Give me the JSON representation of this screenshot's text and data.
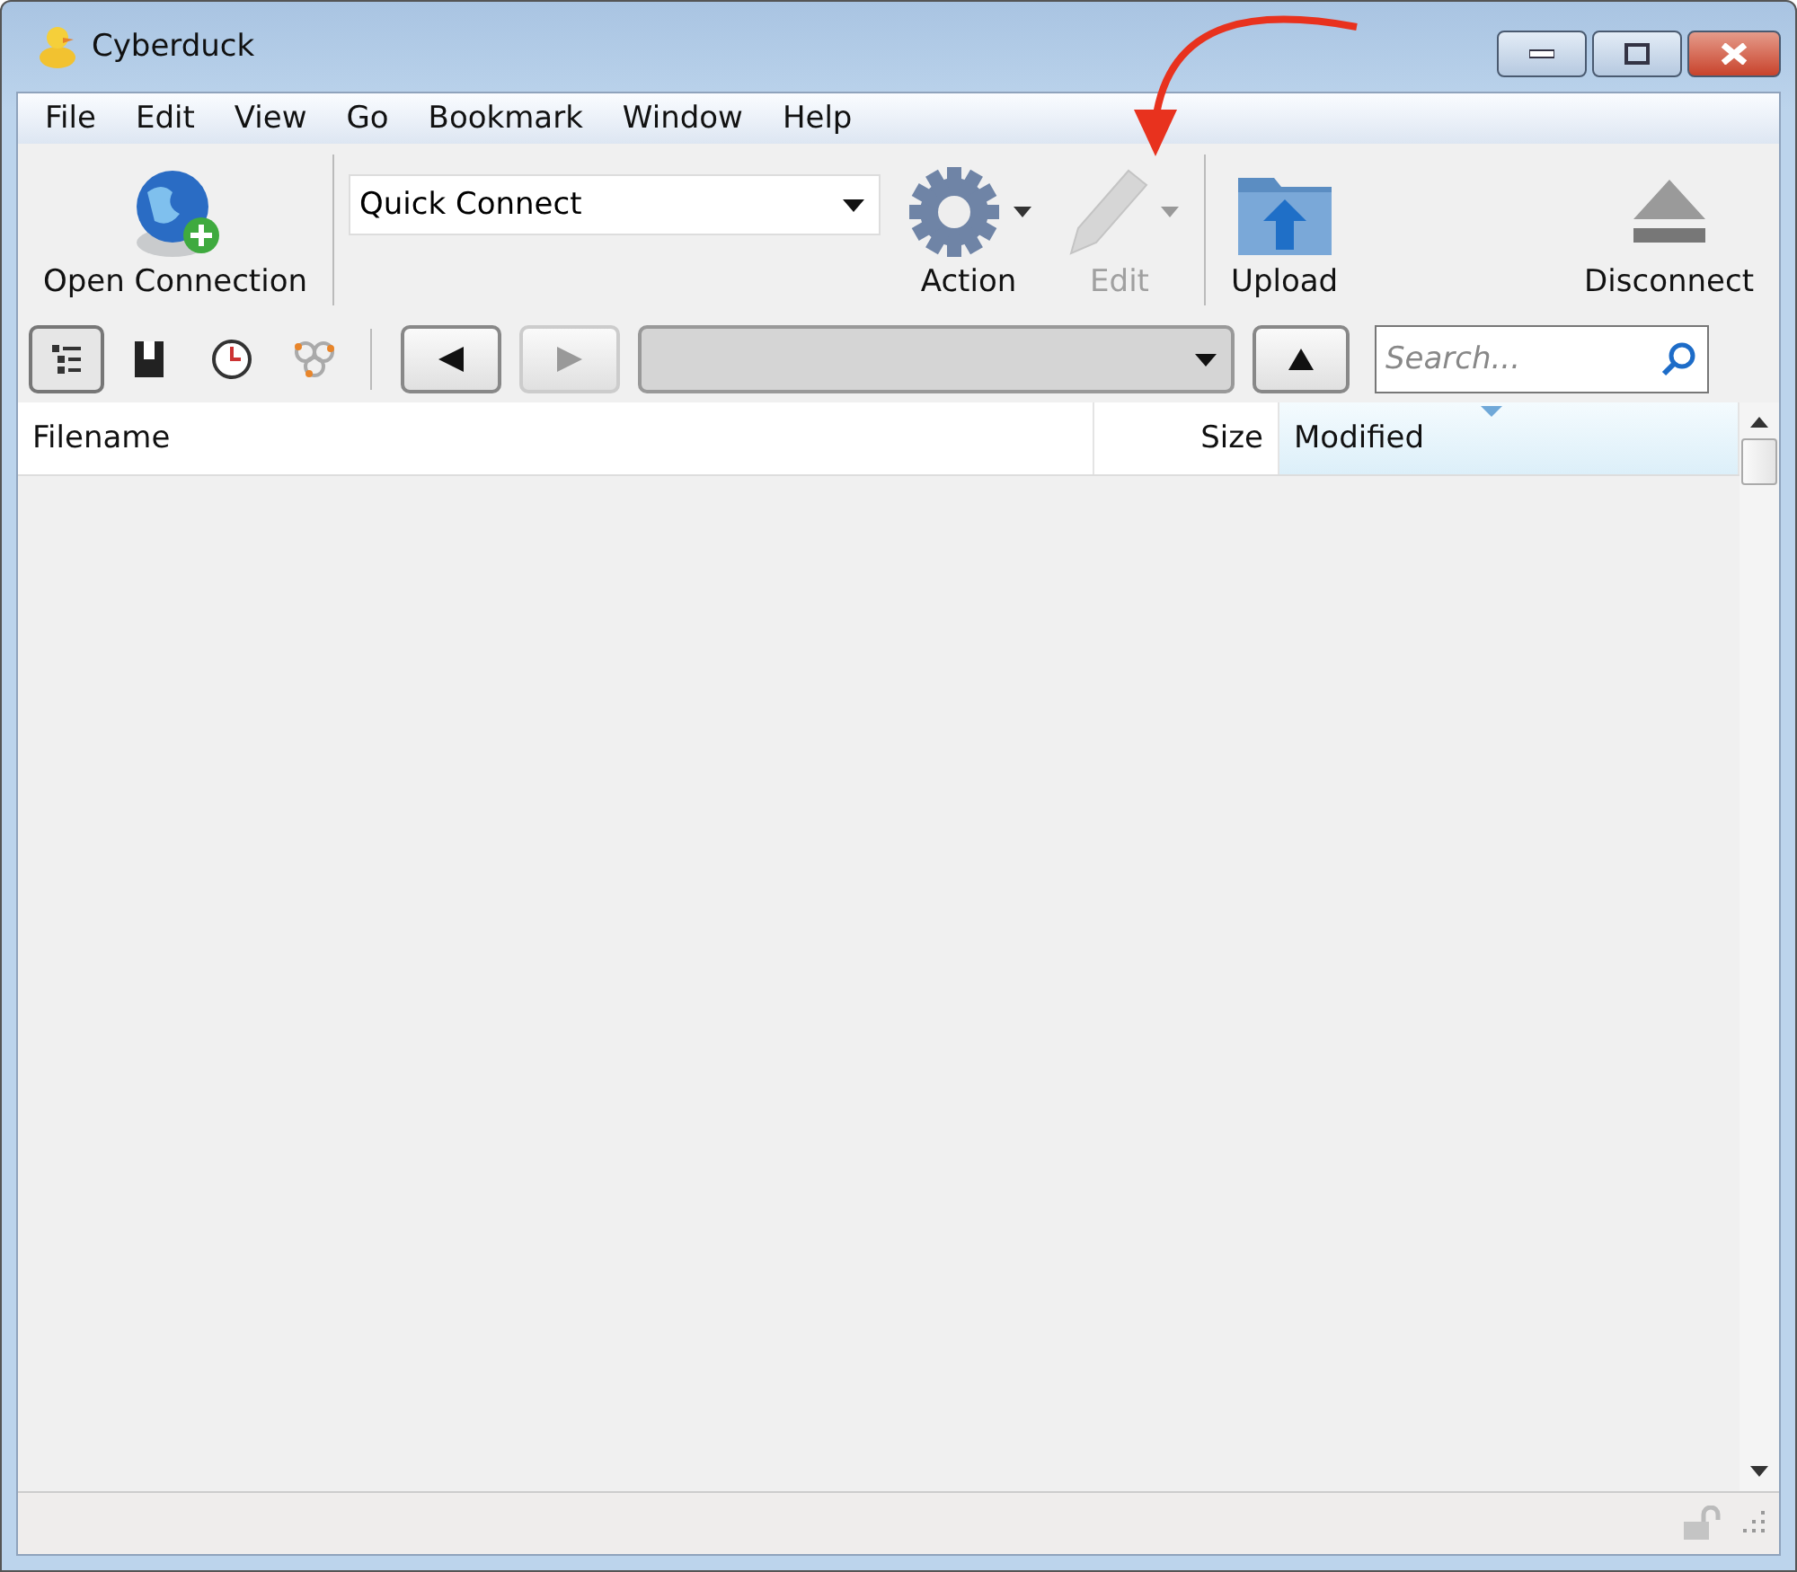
{
  "window": {
    "title": "Cyberduck"
  },
  "menu": [
    "File",
    "Edit",
    "View",
    "Go",
    "Bookmark",
    "Window",
    "Help"
  ],
  "toolbar": [
    {
      "kind": "connect",
      "label": "Open Connection",
      "disabled": false,
      "menu": false
    },
    {
      "kind": "combo",
      "value": "Quick Connect"
    },
    {
      "kind": "action",
      "label": "Action",
      "disabled": false,
      "menu": true
    },
    {
      "kind": "edit",
      "label": "Edit",
      "disabled": true,
      "menu": true
    },
    {
      "kind": "upload",
      "label": "Upload",
      "disabled": false,
      "menu": false
    },
    {
      "kind": "spacer"
    },
    {
      "kind": "disconnect",
      "label": "Disconnect",
      "disabled": false,
      "menu": false
    }
  ],
  "view_toggles": [
    {
      "selected": true
    },
    {
      "selected": false
    },
    {
      "selected": false
    },
    {
      "selected": false
    }
  ],
  "navigation": {
    "back_disabled": false,
    "forward_disabled": true
  },
  "search": {
    "placeholder": "Search..."
  },
  "table": {
    "columns": [
      {
        "label": "Filename",
        "selected": false
      },
      {
        "label": "Size",
        "selected": false
      },
      {
        "label": "Modified",
        "selected": true
      }
    ]
  },
  "annotation": {
    "arrow": true
  }
}
